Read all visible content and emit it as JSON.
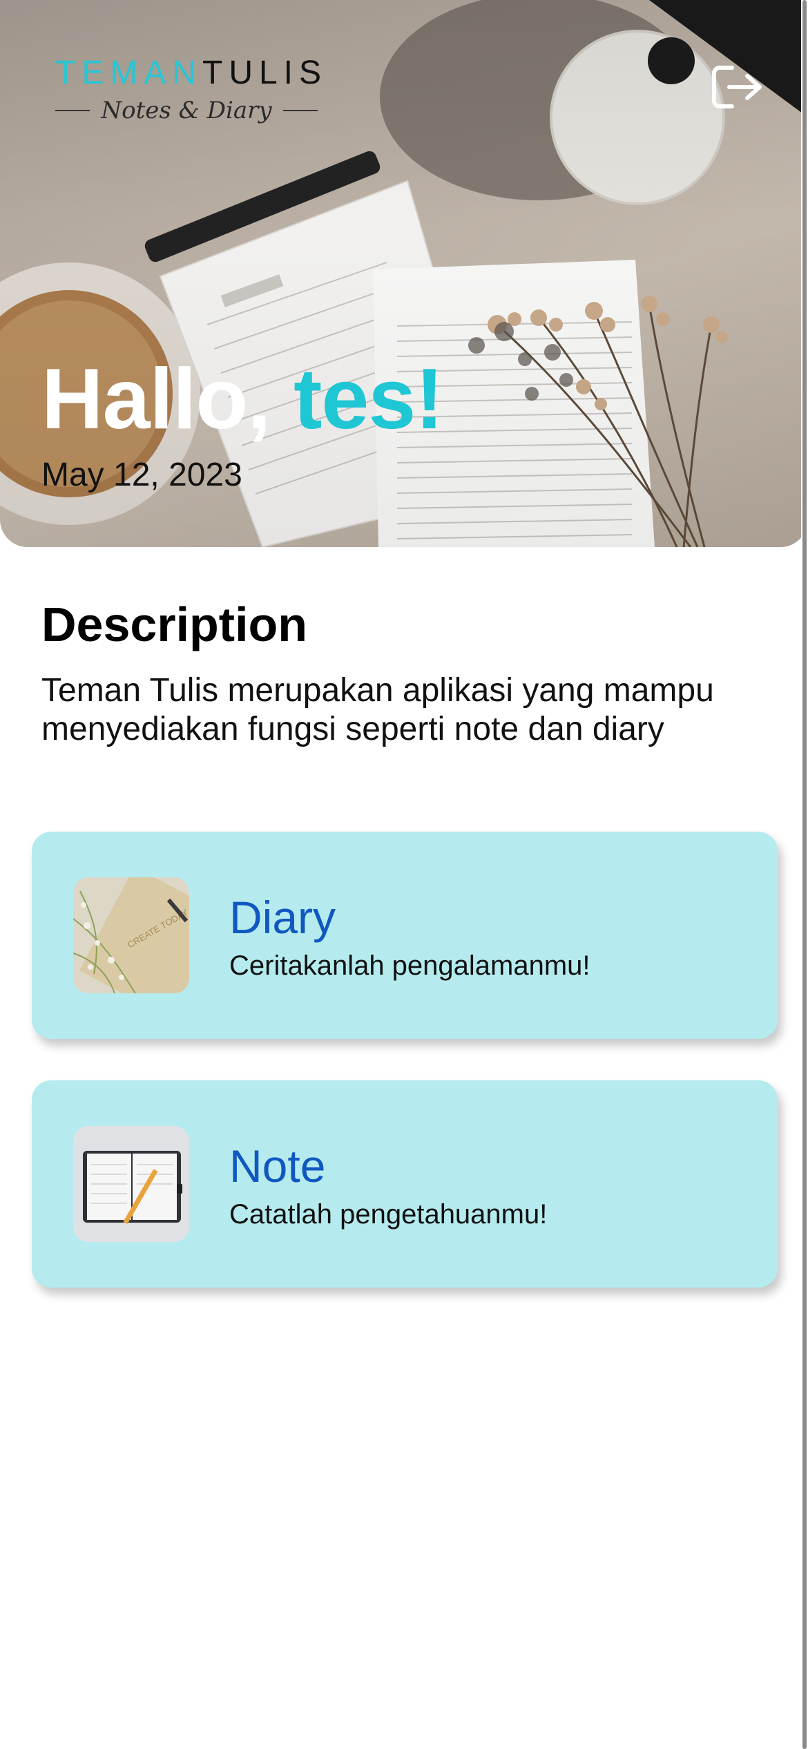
{
  "header": {
    "logo": {
      "word_teman": "TEMAN",
      "word_tulis": "TULIS",
      "tagline": "Notes & Diary"
    },
    "logout_icon": "logout-icon",
    "greeting": "Hallo,",
    "username": "tes!",
    "date": "May 12, 2023"
  },
  "description": {
    "title": "Description",
    "text": "Teman Tulis merupakan aplikasi yang mampu menyediakan fungsi seperti note dan diary"
  },
  "cards": [
    {
      "title": "Diary",
      "subtitle": "Ceritakanlah pengalamanmu!",
      "thumb_text": "CREATE TODAY"
    },
    {
      "title": "Note",
      "subtitle": "Catatlah pengetahuanmu!"
    }
  ],
  "colors": {
    "accent": "#1fc6d4",
    "card_bg": "#b5ebef",
    "card_title": "#1058c0"
  }
}
